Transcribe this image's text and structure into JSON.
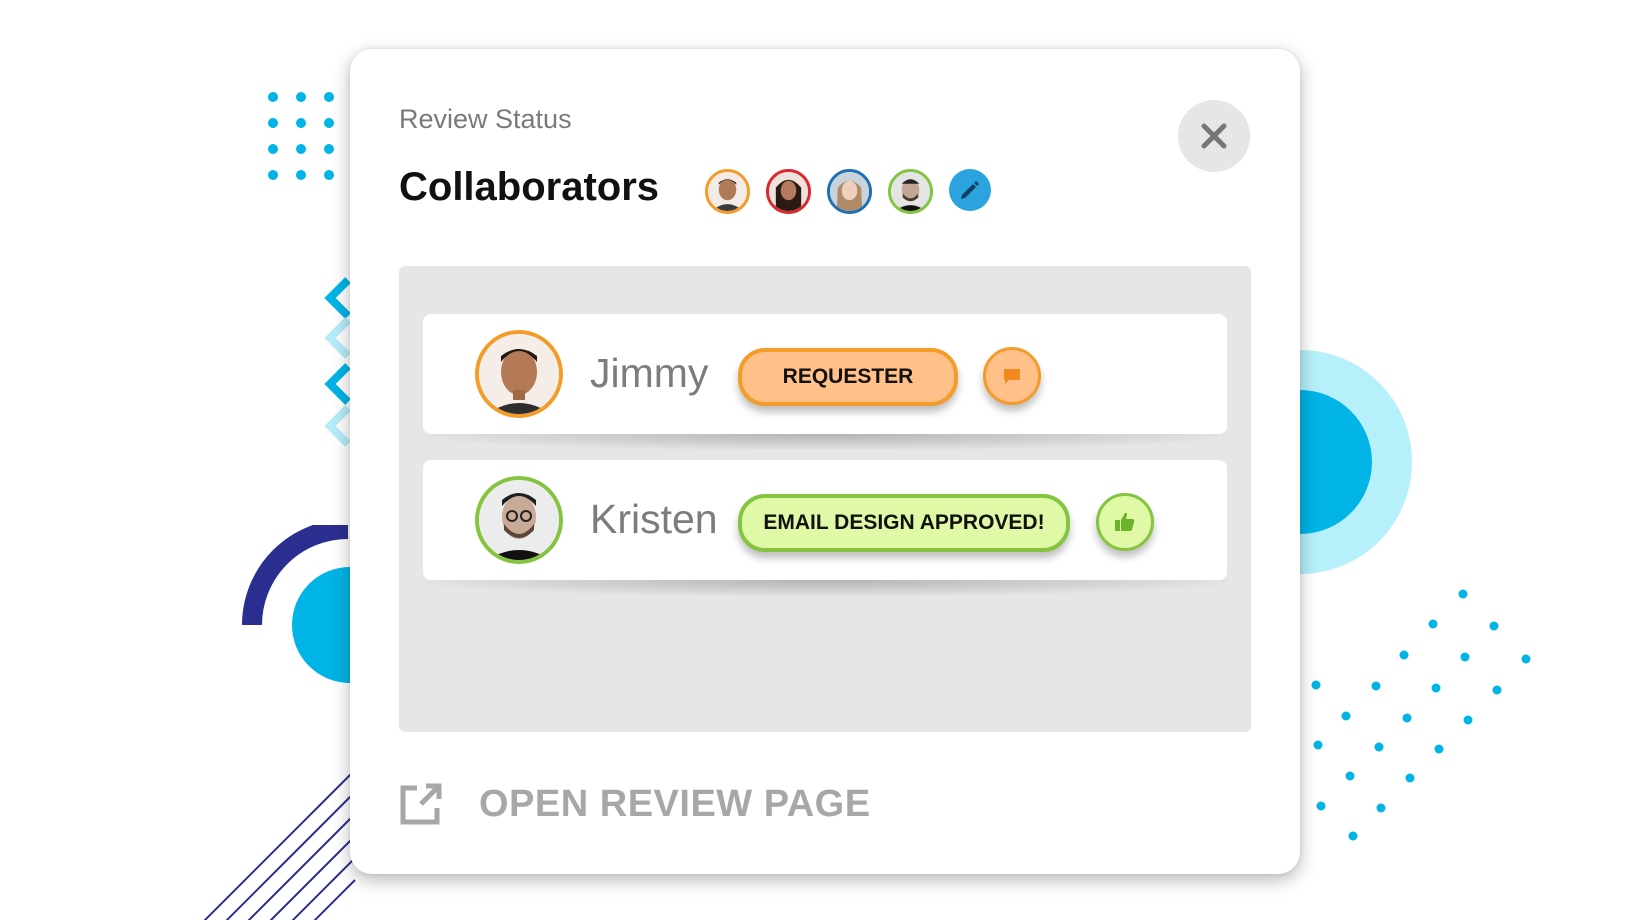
{
  "dialog": {
    "subtitle": "Review Status",
    "title": "Collaborators",
    "close_icon": "close-icon",
    "edit_icon": "pencil-icon"
  },
  "collaborator_avatars": [
    {
      "name": "avatar-1",
      "ring_color": "#f39c2a"
    },
    {
      "name": "avatar-2",
      "ring_color": "#d9282f"
    },
    {
      "name": "avatar-3",
      "ring_color": "#1f6fb5"
    },
    {
      "name": "avatar-4",
      "ring_color": "#84c441"
    }
  ],
  "reviewers": [
    {
      "name": "Jimmy",
      "status": "REQUESTER",
      "action_icon": "comment-icon",
      "accent": "#f39c2a",
      "fill": "#ffc089"
    },
    {
      "name": "Kristen",
      "status": "EMAIL DESIGN APPROVED!",
      "action_icon": "thumbs-up-icon",
      "accent": "#84c441",
      "fill": "#dff9a6"
    }
  ],
  "footer": {
    "open_label": "OPEN REVIEW PAGE",
    "open_icon": "external-link-icon"
  },
  "colors": {
    "brand_cyan": "#00b4e6",
    "navy": "#2a2f8f",
    "panel_gray": "#e6e6e6"
  }
}
